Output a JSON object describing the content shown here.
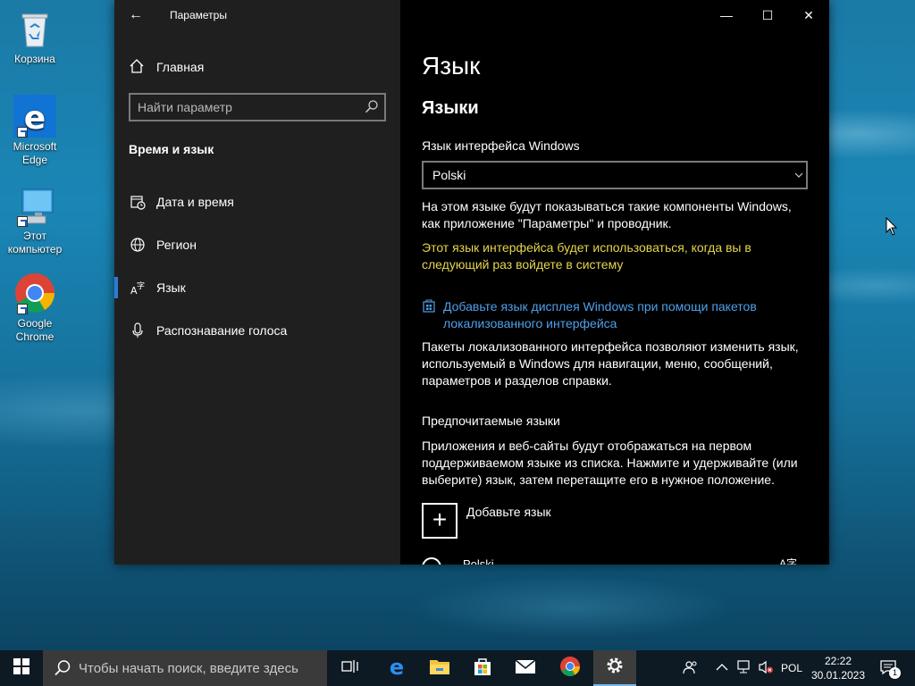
{
  "desktop": {
    "icons": [
      {
        "label": "Корзина",
        "icon": "recycle-bin-icon"
      },
      {
        "label": "Microsoft Edge",
        "icon": "edge-icon"
      },
      {
        "label": "Этот компьютер",
        "icon": "computer-icon"
      },
      {
        "label": "Google Chrome",
        "icon": "chrome-icon"
      }
    ]
  },
  "window": {
    "title": "Параметры",
    "back": "←",
    "minimize": "—",
    "maximize": "☐",
    "close": "✕"
  },
  "nav": {
    "home": "Главная",
    "search_placeholder": "Найти параметр",
    "section": "Время и язык",
    "items": [
      {
        "label": "Дата и время",
        "icon": "calendar-clock-icon"
      },
      {
        "label": "Регион",
        "icon": "globe-icon"
      },
      {
        "label": "Язык",
        "icon": "language-icon",
        "active": true
      },
      {
        "label": "Распознавание голоса",
        "icon": "microphone-icon"
      }
    ]
  },
  "content": {
    "title": "Язык",
    "subtitle": "Языки",
    "display_label": "Язык интерфейса Windows",
    "display_value": "Polski",
    "display_desc": "На этом языке будут показываться такие компоненты Windows, как приложение \"Параметры\" и проводник.",
    "warning": "Этот язык интерфейса будет использоваться, когда вы в следующий раз войдете в систему",
    "link": "Добавьте язык дисплея Windows при помощи пакетов локализованного интерфейса",
    "pack_desc": "Пакеты локализованного интерфейса позволяют изменить язык, используемый в Windows для навигации, меню, сообщений, параметров и разделов справки.",
    "preferred_title": "Предпочитаемые языки",
    "preferred_desc": "Приложения и веб-сайты будут отображаться на первом поддерживаемом языке из списка. Нажмите и удерживайте (или выберите) язык, затем перетащите его в нужное положение.",
    "add_symbol": "+",
    "add_label": "Добавьте язык",
    "languages": [
      {
        "name": "Polski",
        "tag": "A字"
      }
    ]
  },
  "taskbar": {
    "search_placeholder": "Чтобы начать поиск, введите здесь",
    "apps": [
      "task-view-icon",
      "edge-icon",
      "file-explorer-icon",
      "store-icon",
      "mail-icon",
      "chrome-icon",
      "settings-icon"
    ],
    "tray": {
      "lang": "POL",
      "time": "22:22",
      "date": "30.01.2023",
      "notifications": "1"
    }
  },
  "colors": {
    "accent": "#2f7ad6",
    "link": "#4ea0ea",
    "warning": "#e5d54b",
    "nav_bg": "#1f1f1f",
    "content_bg": "#000000"
  }
}
